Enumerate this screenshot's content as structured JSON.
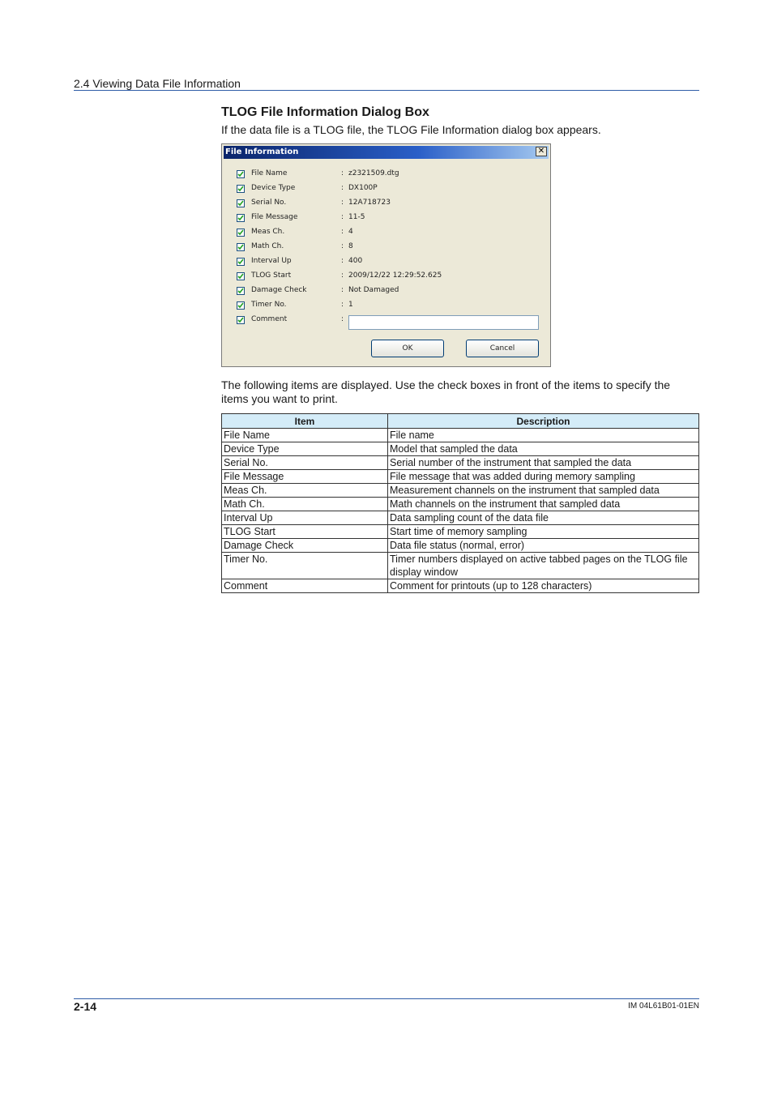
{
  "header": {
    "section": "2.4  Viewing Data File Information"
  },
  "section_title": "TLOG File Information Dialog Box",
  "intro": "If the data file is a TLOG file, the TLOG File Information dialog box appears.",
  "dialog": {
    "title": "File Information",
    "close_label": "✕",
    "fields": [
      {
        "label": "File Name",
        "value": "z2321509.dtg"
      },
      {
        "label": "Device Type",
        "value": "DX100P"
      },
      {
        "label": "Serial No.",
        "value": "12A718723"
      },
      {
        "label": "File Message",
        "value": "11-5"
      },
      {
        "label": "Meas Ch.",
        "value": "4"
      },
      {
        "label": "Math Ch.",
        "value": "8"
      },
      {
        "label": "Interval Up",
        "value": "400"
      },
      {
        "label": "TLOG Start",
        "value": "2009/12/22 12:29:52.625"
      },
      {
        "label": "Damage Check",
        "value": "Not Damaged"
      },
      {
        "label": "Timer No.",
        "value": "1"
      },
      {
        "label": "Comment",
        "value": ""
      }
    ],
    "colon": ":",
    "ok_label": "OK",
    "cancel_label": "Cancel"
  },
  "paragraph": "The following items are displayed. Use the check boxes in front of the items to specify the items you want to print.",
  "table": {
    "headers": [
      "Item",
      "Description"
    ],
    "rows": [
      [
        "File Name",
        "File name"
      ],
      [
        "Device Type",
        "Model that sampled the data"
      ],
      [
        "Serial No.",
        "Serial number of the instrument that sampled the data"
      ],
      [
        "File Message",
        "File message that was added during memory sampling"
      ],
      [
        "Meas Ch.",
        "Measurement channels on the instrument that sampled data"
      ],
      [
        "Math Ch.",
        "Math channels on the instrument that sampled data"
      ],
      [
        "Interval Up",
        "Data sampling count of the data file"
      ],
      [
        "TLOG Start",
        "Start time of memory sampling"
      ],
      [
        "Damage Check",
        "Data file status (normal, error)"
      ],
      [
        "Timer No.",
        "Timer numbers displayed on active tabbed pages on the TLOG file display window"
      ],
      [
        "Comment",
        "Comment for printouts (up to 128 characters)"
      ]
    ]
  },
  "footer": {
    "page": "2-14",
    "doc_id": "IM 04L61B01-01EN"
  }
}
